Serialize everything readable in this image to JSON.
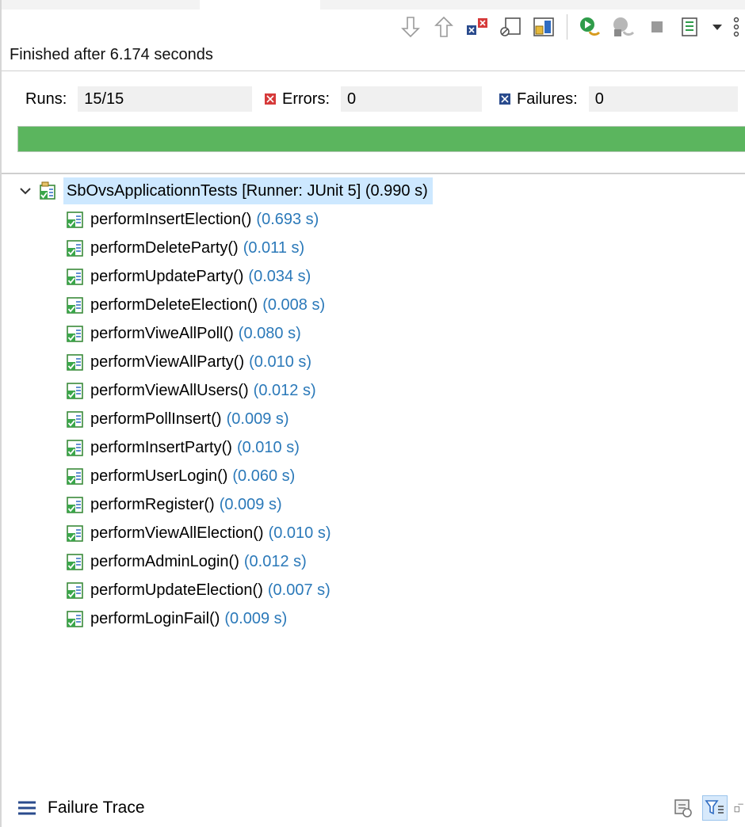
{
  "status": {
    "finished_text": "Finished after 6.174 seconds"
  },
  "counters": {
    "runs_label": "Runs:",
    "runs_value": "15/15",
    "errors_label": "Errors:",
    "errors_value": "0",
    "failures_label": "Failures:",
    "failures_value": "0"
  },
  "progress": {
    "fraction": 1.0,
    "color": "#5bb55e"
  },
  "tree": {
    "root": {
      "label": "SbOvsApplicationnTests [Runner: JUnit 5] (0.990 s)"
    },
    "tests": [
      {
        "name": "performInsertElection()",
        "duration": "(0.693 s)"
      },
      {
        "name": "performDeleteParty()",
        "duration": "(0.011 s)"
      },
      {
        "name": "performUpdateParty()",
        "duration": "(0.034 s)"
      },
      {
        "name": "performDeleteElection()",
        "duration": "(0.008 s)"
      },
      {
        "name": "performViweAllPoll()",
        "duration": "(0.080 s)"
      },
      {
        "name": "performViewAllParty()",
        "duration": "(0.010 s)"
      },
      {
        "name": "performViewAllUsers()",
        "duration": "(0.012 s)"
      },
      {
        "name": "performPollInsert()",
        "duration": "(0.009 s)"
      },
      {
        "name": "performInsertParty()",
        "duration": "(0.010 s)"
      },
      {
        "name": "performUserLogin()",
        "duration": "(0.060 s)"
      },
      {
        "name": "performRegister()",
        "duration": "(0.009 s)"
      },
      {
        "name": "performViewAllElection()",
        "duration": "(0.010 s)"
      },
      {
        "name": "performAdminLogin()",
        "duration": "(0.012 s)"
      },
      {
        "name": "performUpdateElection()",
        "duration": "(0.007 s)"
      },
      {
        "name": "performLoginFail()",
        "duration": "(0.009 s)"
      }
    ]
  },
  "bottom": {
    "failure_trace_label": "Failure Trace"
  }
}
